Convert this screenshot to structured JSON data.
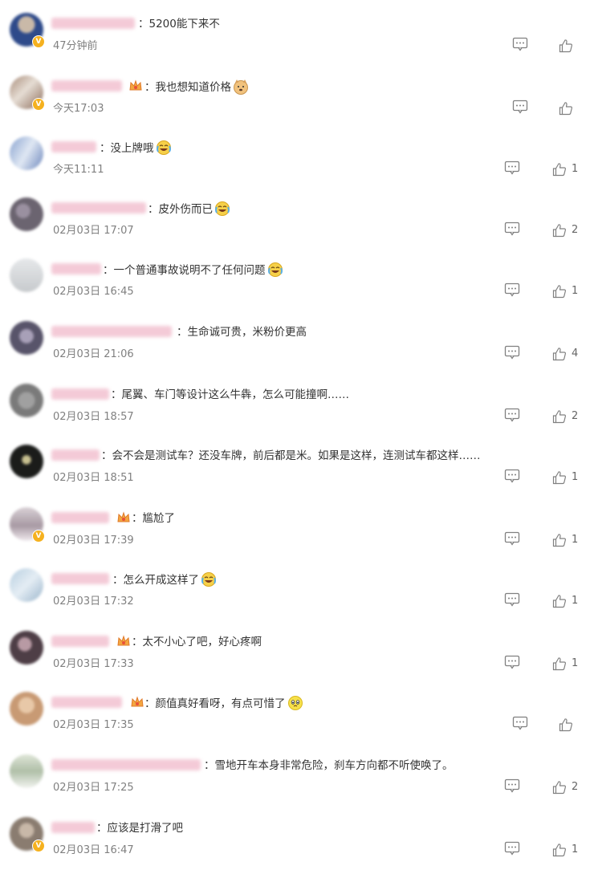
{
  "colors": {
    "text": "#333333",
    "time": "#808080",
    "verified_badge": "#f5b11f",
    "blurred_name": "#f3c5d3",
    "icon_stroke": "#808080"
  },
  "icons": {
    "reply": "comment-reply-icon",
    "like": "thumbs-up-icon",
    "verified": "verified-badge-icon",
    "member": "crown-icon"
  },
  "comments": [
    {
      "text": "5200能下来不",
      "time": "47分钟前",
      "likes": "",
      "emoji": ""
    },
    {
      "text": "我也想知道价格",
      "time": "今天17:03",
      "likes": "",
      "emoji": "doge"
    },
    {
      "text": "没上牌哦",
      "time": "今天11:11",
      "likes": "1",
      "emoji": "laugh-cry"
    },
    {
      "text": "皮外伤而已",
      "time": "02月03日 17:07",
      "likes": "2",
      "emoji": "laugh-cry"
    },
    {
      "text": "一个普通事故说明不了任何问题",
      "time": "02月03日 16:45",
      "likes": "1",
      "emoji": "laugh-cry"
    },
    {
      "text": "生命诚可贵，米粉价更高",
      "time": "02月03日 21:06",
      "likes": "4",
      "emoji": ""
    },
    {
      "text": "尾翼、车门等设计这么牛犇，怎么可能撞啊……",
      "time": "02月03日 18:57",
      "likes": "2",
      "emoji": ""
    },
    {
      "text": "会不会是测试车？还没车牌，前后都是米。如果是这样，连测试车都这样……",
      "time": "02月03日 18:51",
      "likes": "1",
      "emoji": ""
    },
    {
      "text": "尴尬了",
      "time": "02月03日 17:39",
      "likes": "1",
      "emoji": ""
    },
    {
      "text": "怎么开成这样了",
      "time": "02月03日 17:32",
      "likes": "1",
      "emoji": "laugh-cry"
    },
    {
      "text": "太不小心了吧，好心疼啊",
      "time": "02月03日 17:33",
      "likes": "1",
      "emoji": ""
    },
    {
      "text": "颜值真好看呀，有点可惜了",
      "time": "02月03日 17:35",
      "likes": "",
      "emoji": "pity"
    },
    {
      "text": "雪地开车本身非常危险，刹车方向都不听使唤了。",
      "time": "02月03日 17:25",
      "likes": "2",
      "emoji": ""
    },
    {
      "text": "应该是打滑了吧",
      "time": "02月03日 16:47",
      "likes": "1",
      "emoji": ""
    }
  ]
}
